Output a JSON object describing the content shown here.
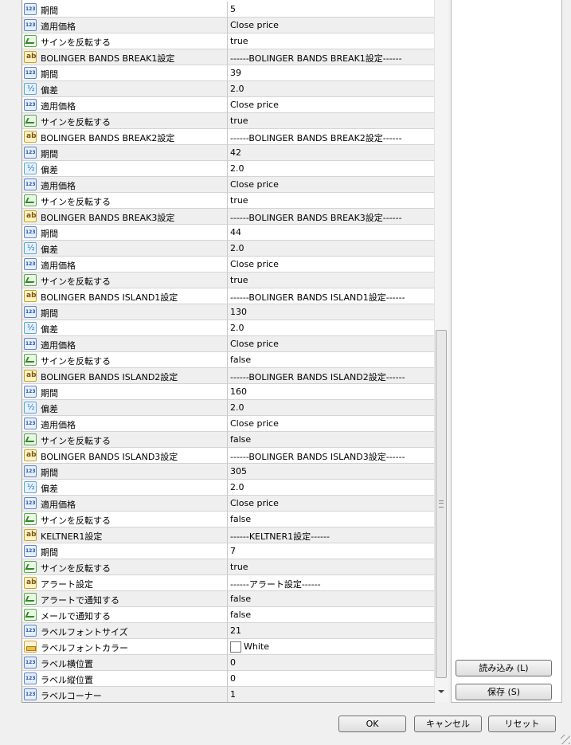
{
  "params": [
    {
      "type": "int",
      "name": "期間",
      "value": "5"
    },
    {
      "type": "int",
      "name": "適用価格",
      "value": "Close price"
    },
    {
      "type": "bool",
      "name": "サインを反転する",
      "value": "true"
    },
    {
      "type": "str",
      "name": "BOLINGER BANDS BREAK1設定",
      "value": "------BOLINGER BANDS BREAK1設定------"
    },
    {
      "type": "int",
      "name": "期間",
      "value": "39"
    },
    {
      "type": "dbl",
      "name": "偏差",
      "value": "2.0"
    },
    {
      "type": "int",
      "name": "適用価格",
      "value": "Close price"
    },
    {
      "type": "bool",
      "name": "サインを反転する",
      "value": "true"
    },
    {
      "type": "str",
      "name": "BOLINGER BANDS BREAK2設定",
      "value": "------BOLINGER BANDS BREAK2設定------"
    },
    {
      "type": "int",
      "name": "期間",
      "value": "42"
    },
    {
      "type": "dbl",
      "name": "偏差",
      "value": "2.0"
    },
    {
      "type": "int",
      "name": "適用価格",
      "value": "Close price"
    },
    {
      "type": "bool",
      "name": "サインを反転する",
      "value": "true"
    },
    {
      "type": "str",
      "name": "BOLINGER BANDS BREAK3設定",
      "value": "------BOLINGER BANDS BREAK3設定------"
    },
    {
      "type": "int",
      "name": "期間",
      "value": "44"
    },
    {
      "type": "dbl",
      "name": "偏差",
      "value": "2.0"
    },
    {
      "type": "int",
      "name": "適用価格",
      "value": "Close price"
    },
    {
      "type": "bool",
      "name": "サインを反転する",
      "value": "true"
    },
    {
      "type": "str",
      "name": "BOLINGER BANDS ISLAND1設定",
      "value": "------BOLINGER BANDS ISLAND1設定------"
    },
    {
      "type": "int",
      "name": "期間",
      "value": "130"
    },
    {
      "type": "dbl",
      "name": "偏差",
      "value": "2.0"
    },
    {
      "type": "int",
      "name": "適用価格",
      "value": "Close price"
    },
    {
      "type": "bool",
      "name": "サインを反転する",
      "value": "false"
    },
    {
      "type": "str",
      "name": "BOLINGER BANDS ISLAND2設定",
      "value": "------BOLINGER BANDS ISLAND2設定------"
    },
    {
      "type": "int",
      "name": "期間",
      "value": "160"
    },
    {
      "type": "dbl",
      "name": "偏差",
      "value": "2.0"
    },
    {
      "type": "int",
      "name": "適用価格",
      "value": "Close price"
    },
    {
      "type": "bool",
      "name": "サインを反転する",
      "value": "false"
    },
    {
      "type": "str",
      "name": "BOLINGER BANDS ISLAND3設定",
      "value": "------BOLINGER BANDS ISLAND3設定------"
    },
    {
      "type": "int",
      "name": "期間",
      "value": "305"
    },
    {
      "type": "dbl",
      "name": "偏差",
      "value": "2.0"
    },
    {
      "type": "int",
      "name": "適用価格",
      "value": "Close price"
    },
    {
      "type": "bool",
      "name": "サインを反転する",
      "value": "false"
    },
    {
      "type": "str",
      "name": "KELTNER1設定",
      "value": "------KELTNER1設定------"
    },
    {
      "type": "int",
      "name": "期間",
      "value": "7"
    },
    {
      "type": "bool",
      "name": "サインを反転する",
      "value": "true"
    },
    {
      "type": "str",
      "name": "アラート設定",
      "value": "------アラート設定------"
    },
    {
      "type": "bool",
      "name": "アラートで通知する",
      "value": "false"
    },
    {
      "type": "bool",
      "name": "メールで通知する",
      "value": "false"
    },
    {
      "type": "int",
      "name": "ラベルフォントサイズ",
      "value": "21"
    },
    {
      "type": "col",
      "name": "ラベルフォントカラー",
      "value": "White",
      "swatch": "#ffffff"
    },
    {
      "type": "int",
      "name": "ラベル横位置",
      "value": "0"
    },
    {
      "type": "int",
      "name": "ラベル縦位置",
      "value": "0"
    },
    {
      "type": "int",
      "name": "ラベルコーナー",
      "value": "1"
    }
  ],
  "icons": {
    "int": "integer-type-icon",
    "dbl": "double-type-icon",
    "bool": "boolean-type-icon",
    "str": "string-type-icon",
    "col": "color-type-icon"
  },
  "buttons": {
    "load": "読み込み (L)",
    "save": "保存 (S)",
    "ok": "OK",
    "cancel": "キャンセル",
    "reset": "リセット"
  }
}
